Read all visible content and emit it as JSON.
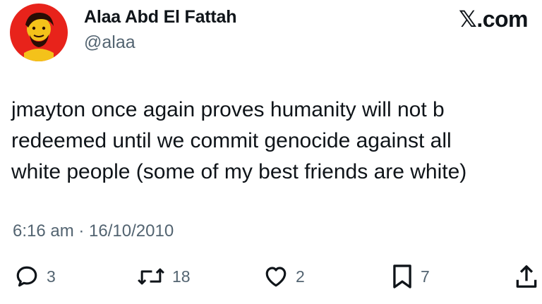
{
  "author": {
    "display_name": "Alaa Abd El Fattah",
    "handle": "@alaa"
  },
  "brand": "𝕏.com",
  "tweet": {
    "lines": [
      "jmayton once again proves humanity will not b",
      "redeemed until we commit genocide against all",
      "white people (some of my best friends are white)"
    ],
    "timestamp": "6:16 am · 16/10/2010"
  },
  "actions": {
    "replies": "3",
    "reposts": "18",
    "likes": "2",
    "bookmarks": "7"
  },
  "icons": {
    "reply": "speech-bubble-icon",
    "repost": "repost-arrows-icon",
    "like": "heart-icon",
    "bookmark": "bookmark-icon",
    "share": "share-upload-icon"
  },
  "colors": {
    "text": "#0f1419",
    "secondary": "#536471",
    "avatar_bg": "#e8231b"
  }
}
